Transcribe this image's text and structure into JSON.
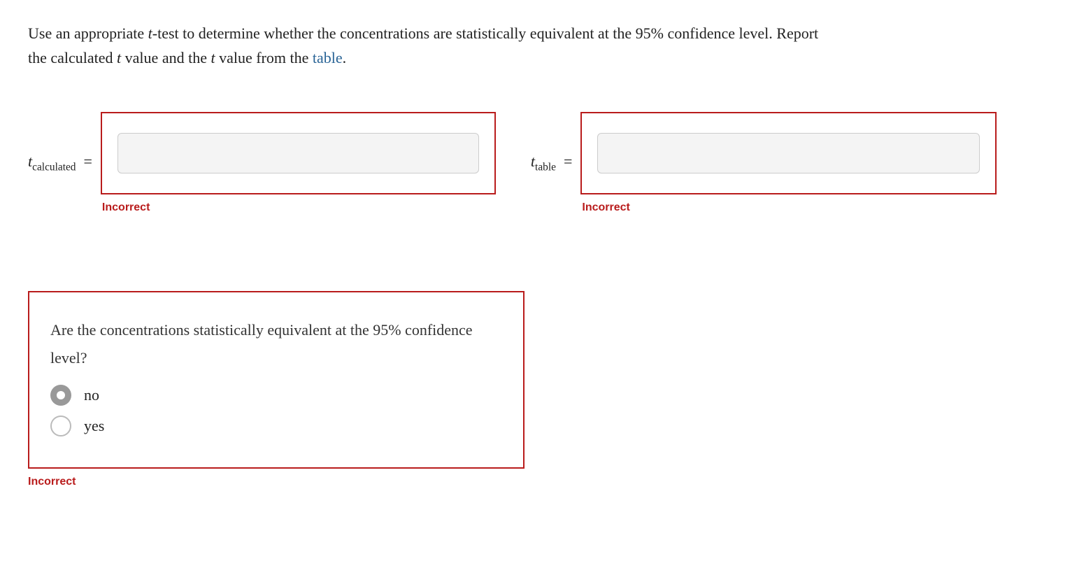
{
  "question": {
    "line1_part1": "Use an appropriate ",
    "line1_italic1": "t",
    "line1_part2": "-test to determine whether the concentrations are statistically equivalent at the 95% confidence level. Report",
    "line2_part1": "the calculated ",
    "line2_italic1": "t",
    "line2_part2": " value and the ",
    "line2_italic2": "t",
    "line2_part3": " value from the ",
    "line2_link": "table",
    "line2_part4": "."
  },
  "inputs": {
    "calculated": {
      "label_t": "t",
      "label_sub": "calculated",
      "equals": "=",
      "value": "",
      "status": "Incorrect"
    },
    "table": {
      "label_t": "t",
      "label_sub": "table",
      "equals": "=",
      "value": "",
      "status": "Incorrect"
    }
  },
  "mc": {
    "question": "Are the concentrations statistically equivalent at the 95% confidence level?",
    "options": {
      "no": "no",
      "yes": "yes"
    },
    "selected": "no",
    "status": "Incorrect"
  }
}
